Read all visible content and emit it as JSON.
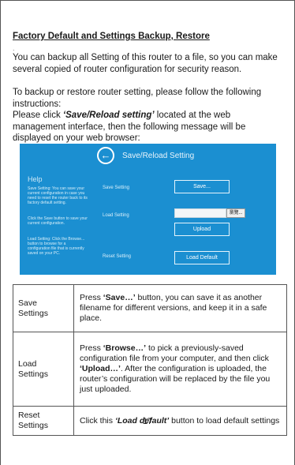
{
  "section": {
    "heading": "Factory Default and Settings Backup, Restore",
    "bullet": ".",
    "intro": "You can backup all Setting of this router to a file, so you can make several copied of router configuration for security reason.",
    "instructions_1": "To backup or restore router setting, please follow the following instructions:",
    "instructions_2_pre": "Please click ",
    "instructions_2_em": "‘Save/Reload setting’",
    "instructions_2_post": " located at the web management interface, then the following message will be displayed on your web browser:"
  },
  "screenshot": {
    "back_icon": "back-arrow-icon",
    "title": "Save/Reload Setting",
    "help_title": "Help",
    "help_text_1": "Save Setting: You can save your current configuration in case you need to reset the router back to its factory default setting.",
    "help_text_2": "Click the Save button to save your current configuration.",
    "help_text_3": "Load Setting: Click the Browse... button to browse for a configuration file that is currently saved on your PC.",
    "save_setting_label": "Save Setting",
    "load_setting_label": "Load Setting",
    "reset_setting_label": "Reset Setting",
    "save_button": "Save...",
    "browse_button": "瀏覽...",
    "upload_button": "Upload",
    "load_default_button": "Load Default",
    "accent_color": "#1b8fd1"
  },
  "table": {
    "rows": [
      {
        "name": "Save Settings",
        "desc_pre": "Press ",
        "desc_bold": "‘Save…’",
        "desc_post": " button, you can save it as another filename for different versions, and keep it in a safe place."
      },
      {
        "name": "Load Settings",
        "desc_pre": "Press ",
        "desc_bold": "‘Browse…’",
        "desc_mid": " to pick a previously-saved configuration file from your computer, and then click ",
        "desc_bold2": "‘Upload…’",
        "desc_post": ". After the configuration is uploaded, the router’s configuration will be replaced by the file you just uploaded."
      },
      {
        "name": "Reset Settings",
        "desc_pre": "Click this ",
        "desc_bold": "‘Load default’",
        "desc_post": " button to load default settings"
      }
    ]
  },
  "page_number": "17"
}
